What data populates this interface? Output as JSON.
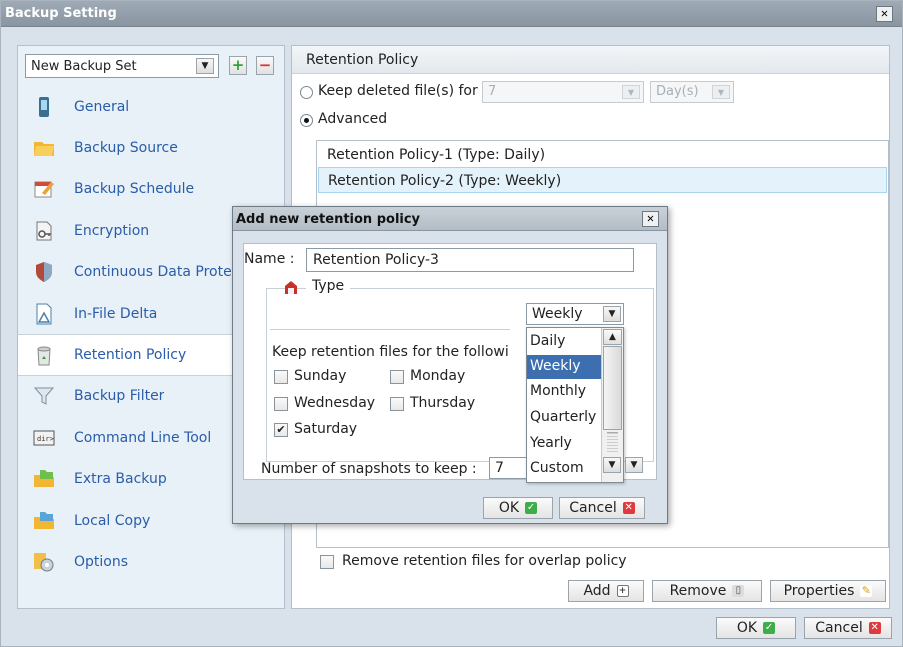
{
  "window": {
    "title": "Backup Setting",
    "close_glyph": "✕"
  },
  "sidebar": {
    "backup_set_value": "New Backup Set",
    "add_label": "+",
    "remove_label": "−",
    "items": [
      {
        "label": "General",
        "icon": "phone-icon"
      },
      {
        "label": "Backup Source",
        "icon": "folder-icon"
      },
      {
        "label": "Backup Schedule",
        "icon": "calendar-icon"
      },
      {
        "label": "Encryption",
        "icon": "key-icon"
      },
      {
        "label": "Continuous Data Protec",
        "icon": "shield-icon"
      },
      {
        "label": "In-File Delta",
        "icon": "document-icon"
      },
      {
        "label": "Retention Policy",
        "icon": "recycle-bin-icon"
      },
      {
        "label": "Backup Filter",
        "icon": "funnel-icon"
      },
      {
        "label": "Command Line Tool",
        "icon": "terminal-icon"
      },
      {
        "label": "Extra Backup",
        "icon": "folders-icon"
      },
      {
        "label": "Local Copy",
        "icon": "folders-icon"
      },
      {
        "label": "Options",
        "icon": "gears-icon"
      }
    ],
    "active_index": 6
  },
  "retention": {
    "header": "Retention Policy",
    "keep_deleted_label": "Keep deleted file(s) for",
    "keep_deleted_value": "7",
    "keep_deleted_unit": "Day(s)",
    "advanced_label": "Advanced",
    "policies": [
      "Retention Policy-1 (Type: Daily)",
      "Retention Policy-2 (Type: Weekly)"
    ],
    "remove_overlap_label": "Remove retention files for overlap policy",
    "add_label": "Add",
    "remove_label": "Remove",
    "properties_label": "Properties"
  },
  "footer": {
    "ok_label": "OK",
    "cancel_label": "Cancel"
  },
  "dialog": {
    "title": "Add new retention policy",
    "name_label": "Name :",
    "name_value": "Retention Policy-3",
    "type_label": "Type",
    "type_value": "Weekly",
    "keep_files_label": "Keep retention files for the followi",
    "days": [
      {
        "label": "Sunday",
        "checked": false
      },
      {
        "label": "Monday",
        "checked": false
      },
      {
        "label": "Wednesday",
        "checked": false
      },
      {
        "label": "Thursday",
        "checked": false
      },
      {
        "label": "Saturday",
        "checked": true
      }
    ],
    "snapshots_label": "Number of snapshots to keep :",
    "snapshots_value": "7",
    "ok_label": "OK",
    "cancel_label": "Cancel",
    "check_glyph": "✔"
  },
  "dropdown": {
    "options": [
      "Daily",
      "Weekly",
      "Monthly",
      "Quarterly",
      "Yearly",
      "Custom"
    ],
    "highlighted": "Weekly"
  }
}
